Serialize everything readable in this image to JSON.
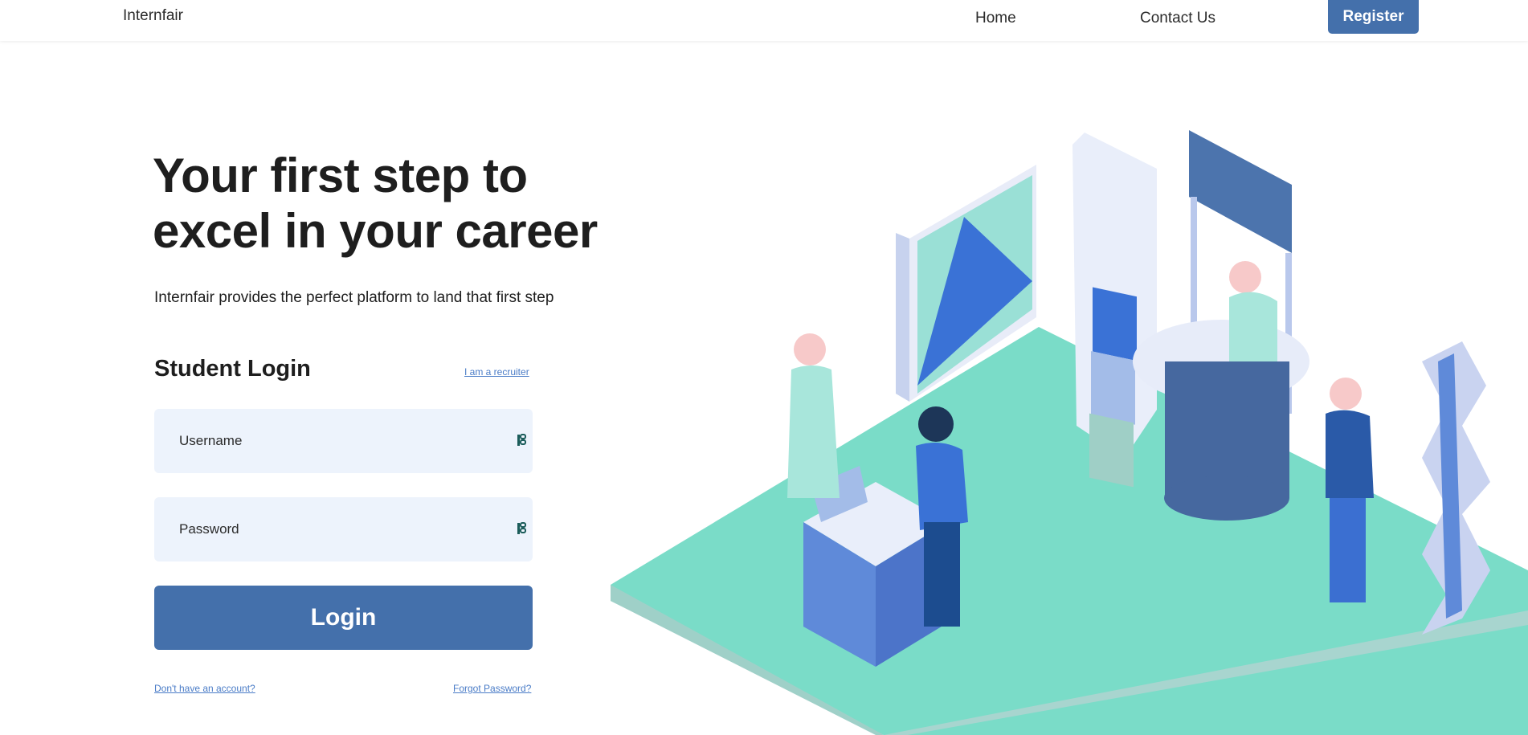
{
  "header": {
    "brand": "Internfair",
    "nav": {
      "home": "Home",
      "contact": "Contact Us"
    },
    "register_label": "Register"
  },
  "hero": {
    "title_line1": "Your first step to",
    "title_line2": "excel in your career",
    "subtitle": "Internfair provides the perfect platform to land that first step"
  },
  "login": {
    "title": "Student Login",
    "recruiter_link": "I am a recruiter",
    "username_placeholder": "Username",
    "password_placeholder": "Password",
    "username_value": "",
    "password_value": "",
    "field_icon": "key-icon",
    "submit_label": "Login",
    "signup_link": "Don't have an account?",
    "forgot_link": "Forgot Password?"
  },
  "colors": {
    "primary": "#4470ab",
    "link": "#4a7cc7",
    "field_bg": "#edf3fc",
    "floor": "#7adcc8"
  }
}
